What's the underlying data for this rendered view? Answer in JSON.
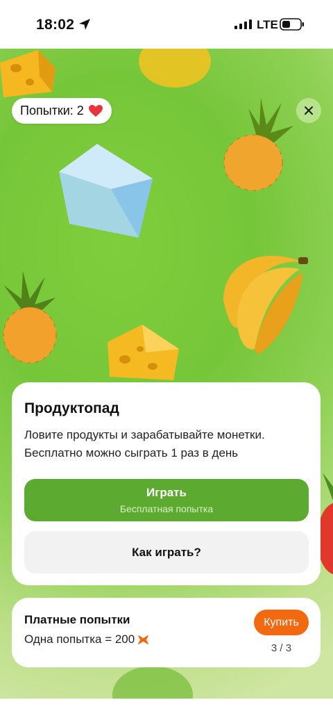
{
  "status_bar": {
    "time": "18:02",
    "network": "LTE"
  },
  "game": {
    "attempts_label": "Попытки: 2",
    "title": "Продуктопад",
    "description": "Ловите продукты и зарабатывайте монетки. Бесплатно можно сыграть 1 раз в день",
    "play_label": "Играть",
    "play_sublabel": "Бесплатная попытка",
    "how_to_label": "Как играть?"
  },
  "paid": {
    "title": "Платные попытки",
    "price_text": "Одна попытка = 200",
    "buy_label": "Купить",
    "count": "3 / 3"
  },
  "colors": {
    "accent_green": "#5daa30",
    "accent_orange": "#f3690f"
  },
  "icons": [
    "location-arrow-icon",
    "signal-icon",
    "battery-icon",
    "heart-icon",
    "close-icon",
    "coin-icon"
  ]
}
